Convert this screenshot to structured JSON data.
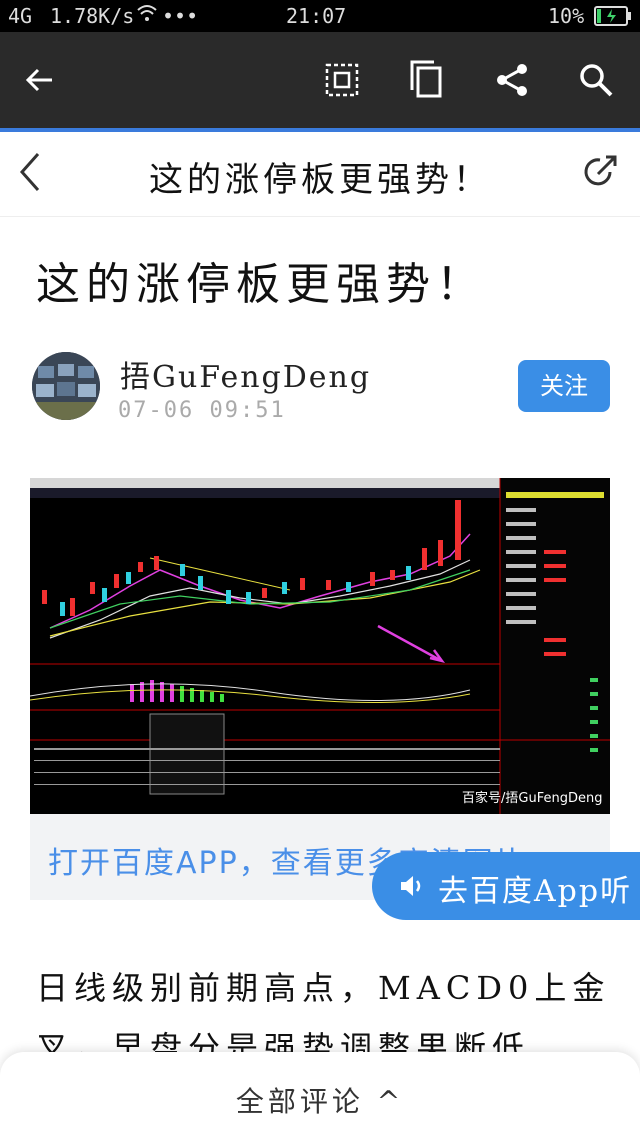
{
  "status": {
    "signal": "4G",
    "speed": "1.78K/s",
    "dots": "•••",
    "time": "21:07",
    "battery": "10%"
  },
  "toolbar": {
    "icons": [
      "back-arrow-icon",
      "reader-mode-icon",
      "copy-icon",
      "share-icon",
      "search-icon"
    ]
  },
  "nav": {
    "title": "这的涨停板更强势！"
  },
  "article": {
    "title": "这的涨停板更强势！",
    "author": "捂GuFengDeng",
    "date": "07-06 09:51",
    "follow_label": "关注",
    "watermark": "百家号/捂GuFengDeng",
    "open_app": "打开百度APP，查看更多高清图片 >",
    "listen_label": "去百度App听",
    "body_line1": "日线级别前期高点，MACD0上金",
    "body_line2": "叉，早盘分是强势调整果断低"
  },
  "bottom": {
    "comments_label": "全部评论 ^"
  },
  "colors": {
    "accent": "#3a8ee6",
    "toolbar": "#2a2a2a"
  }
}
